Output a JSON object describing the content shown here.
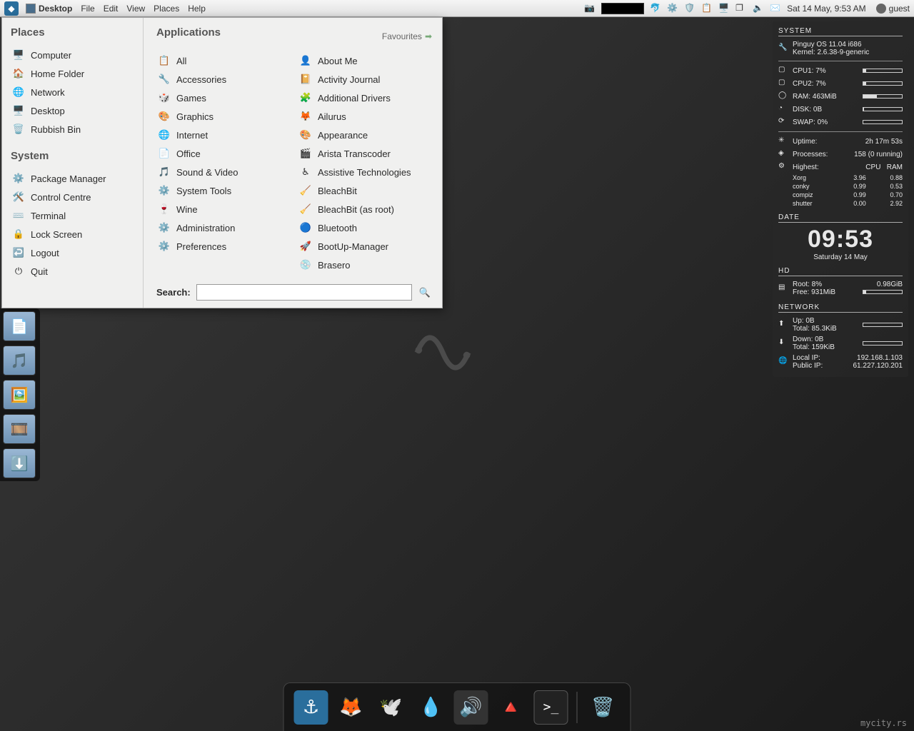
{
  "top_panel": {
    "desktop_label": "Desktop",
    "menus": [
      "File",
      "Edit",
      "View",
      "Places",
      "Help"
    ],
    "clock": "Sat 14 May,  9:53 AM",
    "user": "guest"
  },
  "appmenu": {
    "places_title": "Places",
    "places": [
      {
        "icon": "🖥️",
        "label": "Computer"
      },
      {
        "icon": "🏠",
        "label": "Home Folder"
      },
      {
        "icon": "🌐",
        "label": "Network"
      },
      {
        "icon": "🖥️",
        "label": "Desktop"
      },
      {
        "icon": "🗑️",
        "label": "Rubbish Bin"
      }
    ],
    "system_title": "System",
    "system": [
      {
        "icon": "⚙️",
        "label": "Package Manager"
      },
      {
        "icon": "🛠️",
        "label": "Control Centre"
      },
      {
        "icon": "⌨️",
        "label": "Terminal"
      },
      {
        "icon": "🔒",
        "label": "Lock Screen"
      },
      {
        "icon": "↩️",
        "label": "Logout"
      },
      {
        "icon": "⏻",
        "label": "Quit"
      }
    ],
    "apps_title": "Applications",
    "favourites_label": "Favourites",
    "categories": [
      {
        "icon": "📋",
        "label": "All"
      },
      {
        "icon": "🔧",
        "label": "Accessories"
      },
      {
        "icon": "🎲",
        "label": "Games"
      },
      {
        "icon": "🎨",
        "label": "Graphics"
      },
      {
        "icon": "🌐",
        "label": "Internet"
      },
      {
        "icon": "📄",
        "label": "Office"
      },
      {
        "icon": "🎵",
        "label": "Sound & Video"
      },
      {
        "icon": "⚙️",
        "label": "System Tools"
      },
      {
        "icon": "🍷",
        "label": "Wine"
      },
      {
        "icon": "⚙️",
        "label": "Administration"
      },
      {
        "icon": "⚙️",
        "label": "Preferences"
      }
    ],
    "apps": [
      {
        "icon": "👤",
        "label": "About Me"
      },
      {
        "icon": "📔",
        "label": "Activity Journal"
      },
      {
        "icon": "🧩",
        "label": "Additional Drivers"
      },
      {
        "icon": "🦊",
        "label": "Ailurus"
      },
      {
        "icon": "🎨",
        "label": "Appearance"
      },
      {
        "icon": "🎬",
        "label": "Arista Transcoder"
      },
      {
        "icon": "♿",
        "label": "Assistive Technologies"
      },
      {
        "icon": "🧹",
        "label": "BleachBit"
      },
      {
        "icon": "🧹",
        "label": "BleachBit (as root)"
      },
      {
        "icon": "🔵",
        "label": "Bluetooth"
      },
      {
        "icon": "🚀",
        "label": "BootUp-Manager"
      },
      {
        "icon": "💿",
        "label": "Brasero"
      }
    ],
    "search_label": "Search:",
    "search_placeholder": ""
  },
  "left_dock": [
    {
      "name": "documents-folder",
      "icon": "📄"
    },
    {
      "name": "music-folder",
      "icon": "🎵"
    },
    {
      "name": "pictures-folder",
      "icon": "🖼️"
    },
    {
      "name": "videos-folder",
      "icon": "🎞️"
    },
    {
      "name": "downloads-folder",
      "icon": "⬇️"
    }
  ],
  "bottom_dock": [
    {
      "name": "anchor-app",
      "icon": "⚓",
      "bg": "#2a6e9c"
    },
    {
      "name": "firefox",
      "icon": "🦊",
      "bg": "transparent"
    },
    {
      "name": "thunderbird",
      "icon": "🕊️",
      "bg": "transparent"
    },
    {
      "name": "deluge",
      "icon": "💧",
      "bg": "transparent"
    },
    {
      "name": "media-player",
      "icon": "🔊",
      "bg": "#333"
    },
    {
      "name": "vlc",
      "icon": "🔺",
      "bg": "transparent"
    },
    {
      "name": "terminal",
      "icon": ">_",
      "bg": "#222"
    },
    {
      "name": "trash",
      "icon": "🗑️",
      "bg": "transparent"
    }
  ],
  "conky": {
    "system_title": "SYSTEM",
    "os": "Pinguy OS 11.04 i686",
    "kernel": "Kernel: 2.6.38-9-generic",
    "cpu1_label": "CPU1: 7%",
    "cpu1_pct": 7,
    "cpu2_label": "CPU2: 7%",
    "cpu2_pct": 7,
    "ram_label": "RAM: 463MiB",
    "ram_pct": 35,
    "disk_label": "DISK: 0B",
    "disk_pct": 2,
    "swap_label": "SWAP: 0%",
    "swap_pct": 0,
    "uptime_label": "Uptime:",
    "uptime_val": "2h 17m 53s",
    "proc_label": "Processes:",
    "proc_val": "158 (0 running)",
    "highest_label": "Highest:",
    "highest_head_cpu": "CPU",
    "highest_head_ram": "RAM",
    "procs": [
      {
        "name": "Xorg",
        "cpu": "3.96",
        "ram": "0.88"
      },
      {
        "name": "conky",
        "cpu": "0.99",
        "ram": "0.53"
      },
      {
        "name": "compiz",
        "cpu": "0.99",
        "ram": "0.70"
      },
      {
        "name": "shutter",
        "cpu": "0.00",
        "ram": "2.92"
      }
    ],
    "date_title": "DATE",
    "time": "09:53",
    "date": "Saturday 14 May",
    "hd_title": "HD",
    "root_label": "Root: 8%",
    "root_size": "0.98GiB",
    "root_free": "Free: 931MiB",
    "root_pct": 8,
    "net_title": "NETWORK",
    "up_label": "Up: 0B",
    "up_total": "Total: 85.3KiB",
    "down_label": "Down: 0B",
    "down_total": "Total: 159KiB",
    "localip_label": "Local IP:",
    "localip": "192.168.1.103",
    "publicip_label": "Public IP:",
    "publicip": "61.227.120.201"
  },
  "watermark": "mycity.rs"
}
